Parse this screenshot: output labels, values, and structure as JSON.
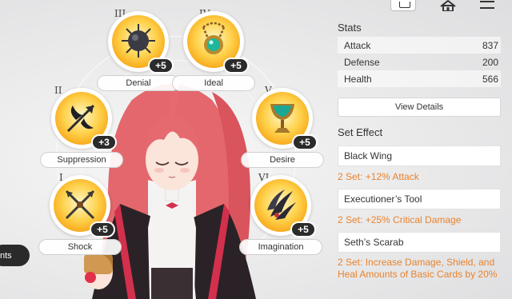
{
  "slots": [
    {
      "roman": "III",
      "level": "+5",
      "name": "Denial",
      "icon": "spiked-mace-icon"
    },
    {
      "roman": "IV",
      "level": "+5",
      "name": "Ideal",
      "icon": "green-pendant-icon"
    },
    {
      "roman": "II",
      "level": "+3",
      "name": "Suppression",
      "icon": "black-wing-arrow-icon"
    },
    {
      "roman": "V",
      "level": "+5",
      "name": "Desire",
      "icon": "golden-chalice-icon"
    },
    {
      "roman": "I",
      "level": "+5",
      "name": "Shock",
      "icon": "crossed-blades-icon"
    },
    {
      "roman": "VI",
      "level": "+5",
      "name": "Imagination",
      "icon": "dark-claw-icon"
    }
  ],
  "hint": {
    "label": "nts"
  },
  "topbar": {
    "icons": [
      "id-card-icon",
      "home-icon",
      "menu-icon"
    ]
  },
  "stats": {
    "title": "Stats",
    "rows": [
      {
        "label": "Attack",
        "value": "837"
      },
      {
        "label": "Defense",
        "value": "200"
      },
      {
        "label": "Health",
        "value": "566"
      }
    ],
    "view_details": "View Details"
  },
  "set_effect": {
    "title": "Set Effect",
    "sets": [
      {
        "name": "Black Wing",
        "desc": "2 Set: +12% Attack"
      },
      {
        "name": "Executioner’s Tool",
        "desc": "2 Set: +25% Critical Damage"
      },
      {
        "name": "Seth’s Scarab",
        "desc": "2 Set: Increase Damage, Shield, and Heal Amounts of Basic Cards by 20%"
      }
    ]
  },
  "colors": {
    "accent_orange": "#e8832e",
    "orb_gold": "#f6a313",
    "badge_dark": "#2b2b2b"
  }
}
